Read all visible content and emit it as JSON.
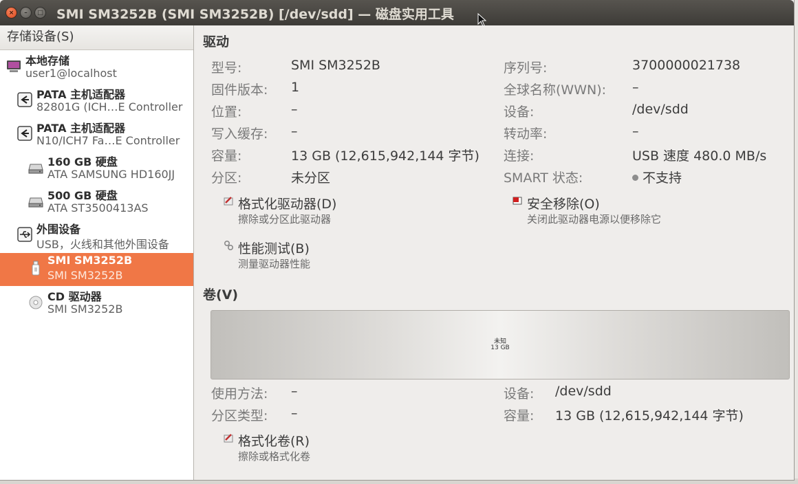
{
  "window": {
    "title": "SMI SM3252B (SMI SM3252B) [/dev/sdd] — 磁盘实用工具",
    "close_glyph": "×",
    "minimize_glyph": "–",
    "maximize_glyph": "□"
  },
  "sidebar": {
    "header": "存储设备(S)",
    "items": [
      {
        "title": "本地存储",
        "subtitle": "user1@localhost",
        "icon": "computer-icon"
      },
      {
        "title": "PATA 主机适配器",
        "subtitle": "82801G (ICH…E Controller",
        "icon": "controller-icon"
      },
      {
        "title": "PATA 主机适配器",
        "subtitle": "N10/ICH7 Fa…E Controller",
        "icon": "controller-icon"
      },
      {
        "title": "160 GB 硬盘",
        "subtitle": "ATA SAMSUNG HD160JJ",
        "icon": "hard-disk-icon"
      },
      {
        "title": "500 GB 硬盘",
        "subtitle": "ATA ST3500413AS",
        "icon": "hard-disk-icon"
      },
      {
        "title": "外围设备",
        "subtitle": "USB，火线和其他外围设备",
        "icon": "usb-icon"
      },
      {
        "title": "SMI SM3252B",
        "subtitle": "SMI SM3252B",
        "icon": "usb-stick-icon",
        "selected": true
      },
      {
        "title": "CD 驱动器",
        "subtitle": "SMI SM3252B",
        "icon": "cd-drive-icon"
      }
    ]
  },
  "drive": {
    "section_title": "驱动",
    "left": [
      {
        "label": "型号:",
        "value": "SMI SM3252B"
      },
      {
        "label": "固件版本:",
        "value": "1"
      },
      {
        "label": "位置:",
        "value": "–"
      },
      {
        "label": "写入缓存:",
        "value": "–"
      },
      {
        "label": "容量:",
        "value": "13 GB (12,615,942,144 字节)"
      },
      {
        "label": "分区:",
        "value": "未分区"
      }
    ],
    "right": [
      {
        "label": "序列号:",
        "value": "3700000021738"
      },
      {
        "label": "全球名称(WWN):",
        "value": "–"
      },
      {
        "label": "设备:",
        "value": "/dev/sdd"
      },
      {
        "label": "转动率:",
        "value": "–"
      },
      {
        "label": "连接:",
        "value": "USB 速度 480.0 MB/s"
      },
      {
        "label": "SMART 状态:",
        "value": "不支持"
      }
    ],
    "actions": {
      "format": {
        "title": "格式化驱动器(D)",
        "desc": "擦除或分区此驱动器"
      },
      "safe_remove": {
        "title": "安全移除(O)",
        "desc": "关闭此驱动器电源以便移除它"
      },
      "benchmark": {
        "title": "性能测试(B)",
        "desc": "测量驱动器性能"
      }
    }
  },
  "volumes": {
    "section_title": "卷(V)",
    "bar": {
      "label1": "未知",
      "label2": "13 GB"
    },
    "left": [
      {
        "label": "使用方法:",
        "value": "–"
      },
      {
        "label": "分区类型:",
        "value": "–"
      }
    ],
    "right": [
      {
        "label": "设备:",
        "value": "/dev/sdd"
      },
      {
        "label": "容量:",
        "value": "13 GB (12,615,942,144 字节)"
      }
    ],
    "actions": {
      "format_volume": {
        "title": "格式化卷(R)",
        "desc": "擦除或格式化卷"
      }
    }
  },
  "colors": {
    "selection": "#f07746",
    "titlebar": "#3d3b37",
    "background": "#efedeb"
  }
}
